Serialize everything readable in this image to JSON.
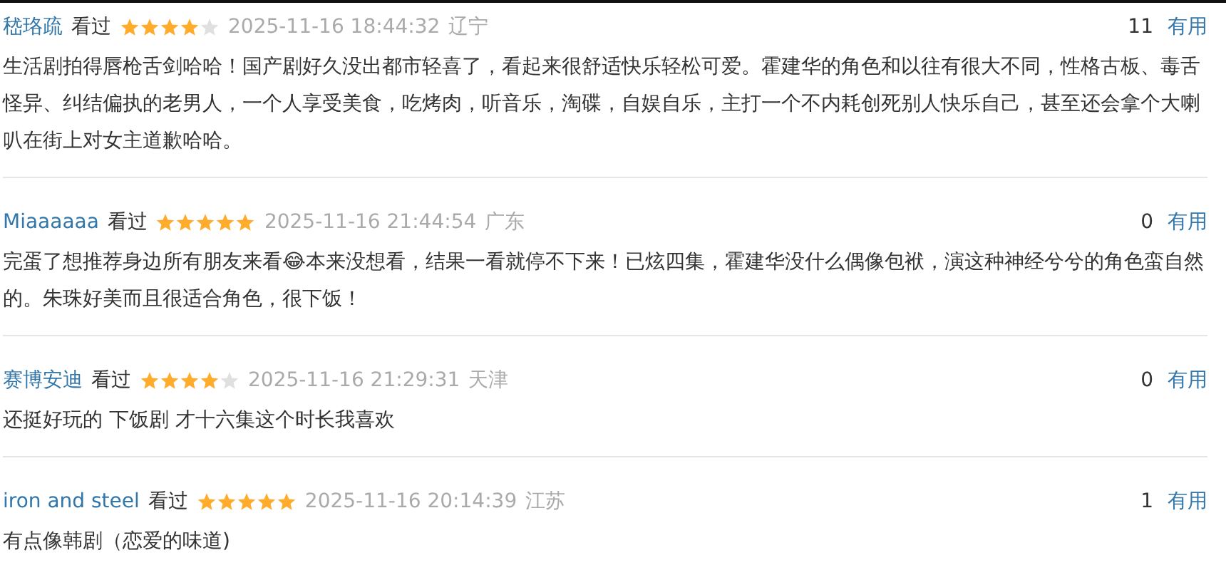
{
  "reviews": [
    {
      "user": "嵇珞疏",
      "status": "看过",
      "stars": 4,
      "time": "2025-11-16 18:44:32",
      "region": "辽宁",
      "votes": "11",
      "vote_label": "有用",
      "text": "生活剧拍得唇枪舌剑哈哈！国产剧好久没出都市轻喜了，看起来很舒适快乐轻松可爱。霍建华的角色和以往有很大不同，性格古板、毒舌怪异、纠结偏执的老男人，一个人享受美食，吃烤肉，听音乐，淘碟，自娱自乐，主打一个不内耗创死别人快乐自己，甚至还会拿个大喇叭在街上对女主道歉哈哈。"
    },
    {
      "user": "Miaaaaaa",
      "status": "看过",
      "stars": 5,
      "time": "2025-11-16 21:44:54",
      "region": "广东",
      "votes": "0",
      "vote_label": "有用",
      "text": "完蛋了想推荐身边所有朋友来看😂本来没想看，结果一看就停不下来！已炫四集，霍建华没什么偶像包袱，演这种神经兮兮的角色蛮自然的。朱珠好美而且很适合角色，很下饭！"
    },
    {
      "user": "赛博安迪",
      "status": "看过",
      "stars": 4,
      "time": "2025-11-16 21:29:31",
      "region": "天津",
      "votes": "0",
      "vote_label": "有用",
      "text": "还挺好玩的 下饭剧 才十六集这个时长我喜欢"
    },
    {
      "user": "iron and steel",
      "status": "看过",
      "stars": 5,
      "time": "2025-11-16 20:14:39",
      "region": "江苏",
      "votes": "1",
      "vote_label": "有用",
      "text": "有点像韩剧（恋爱的味道)"
    }
  ]
}
